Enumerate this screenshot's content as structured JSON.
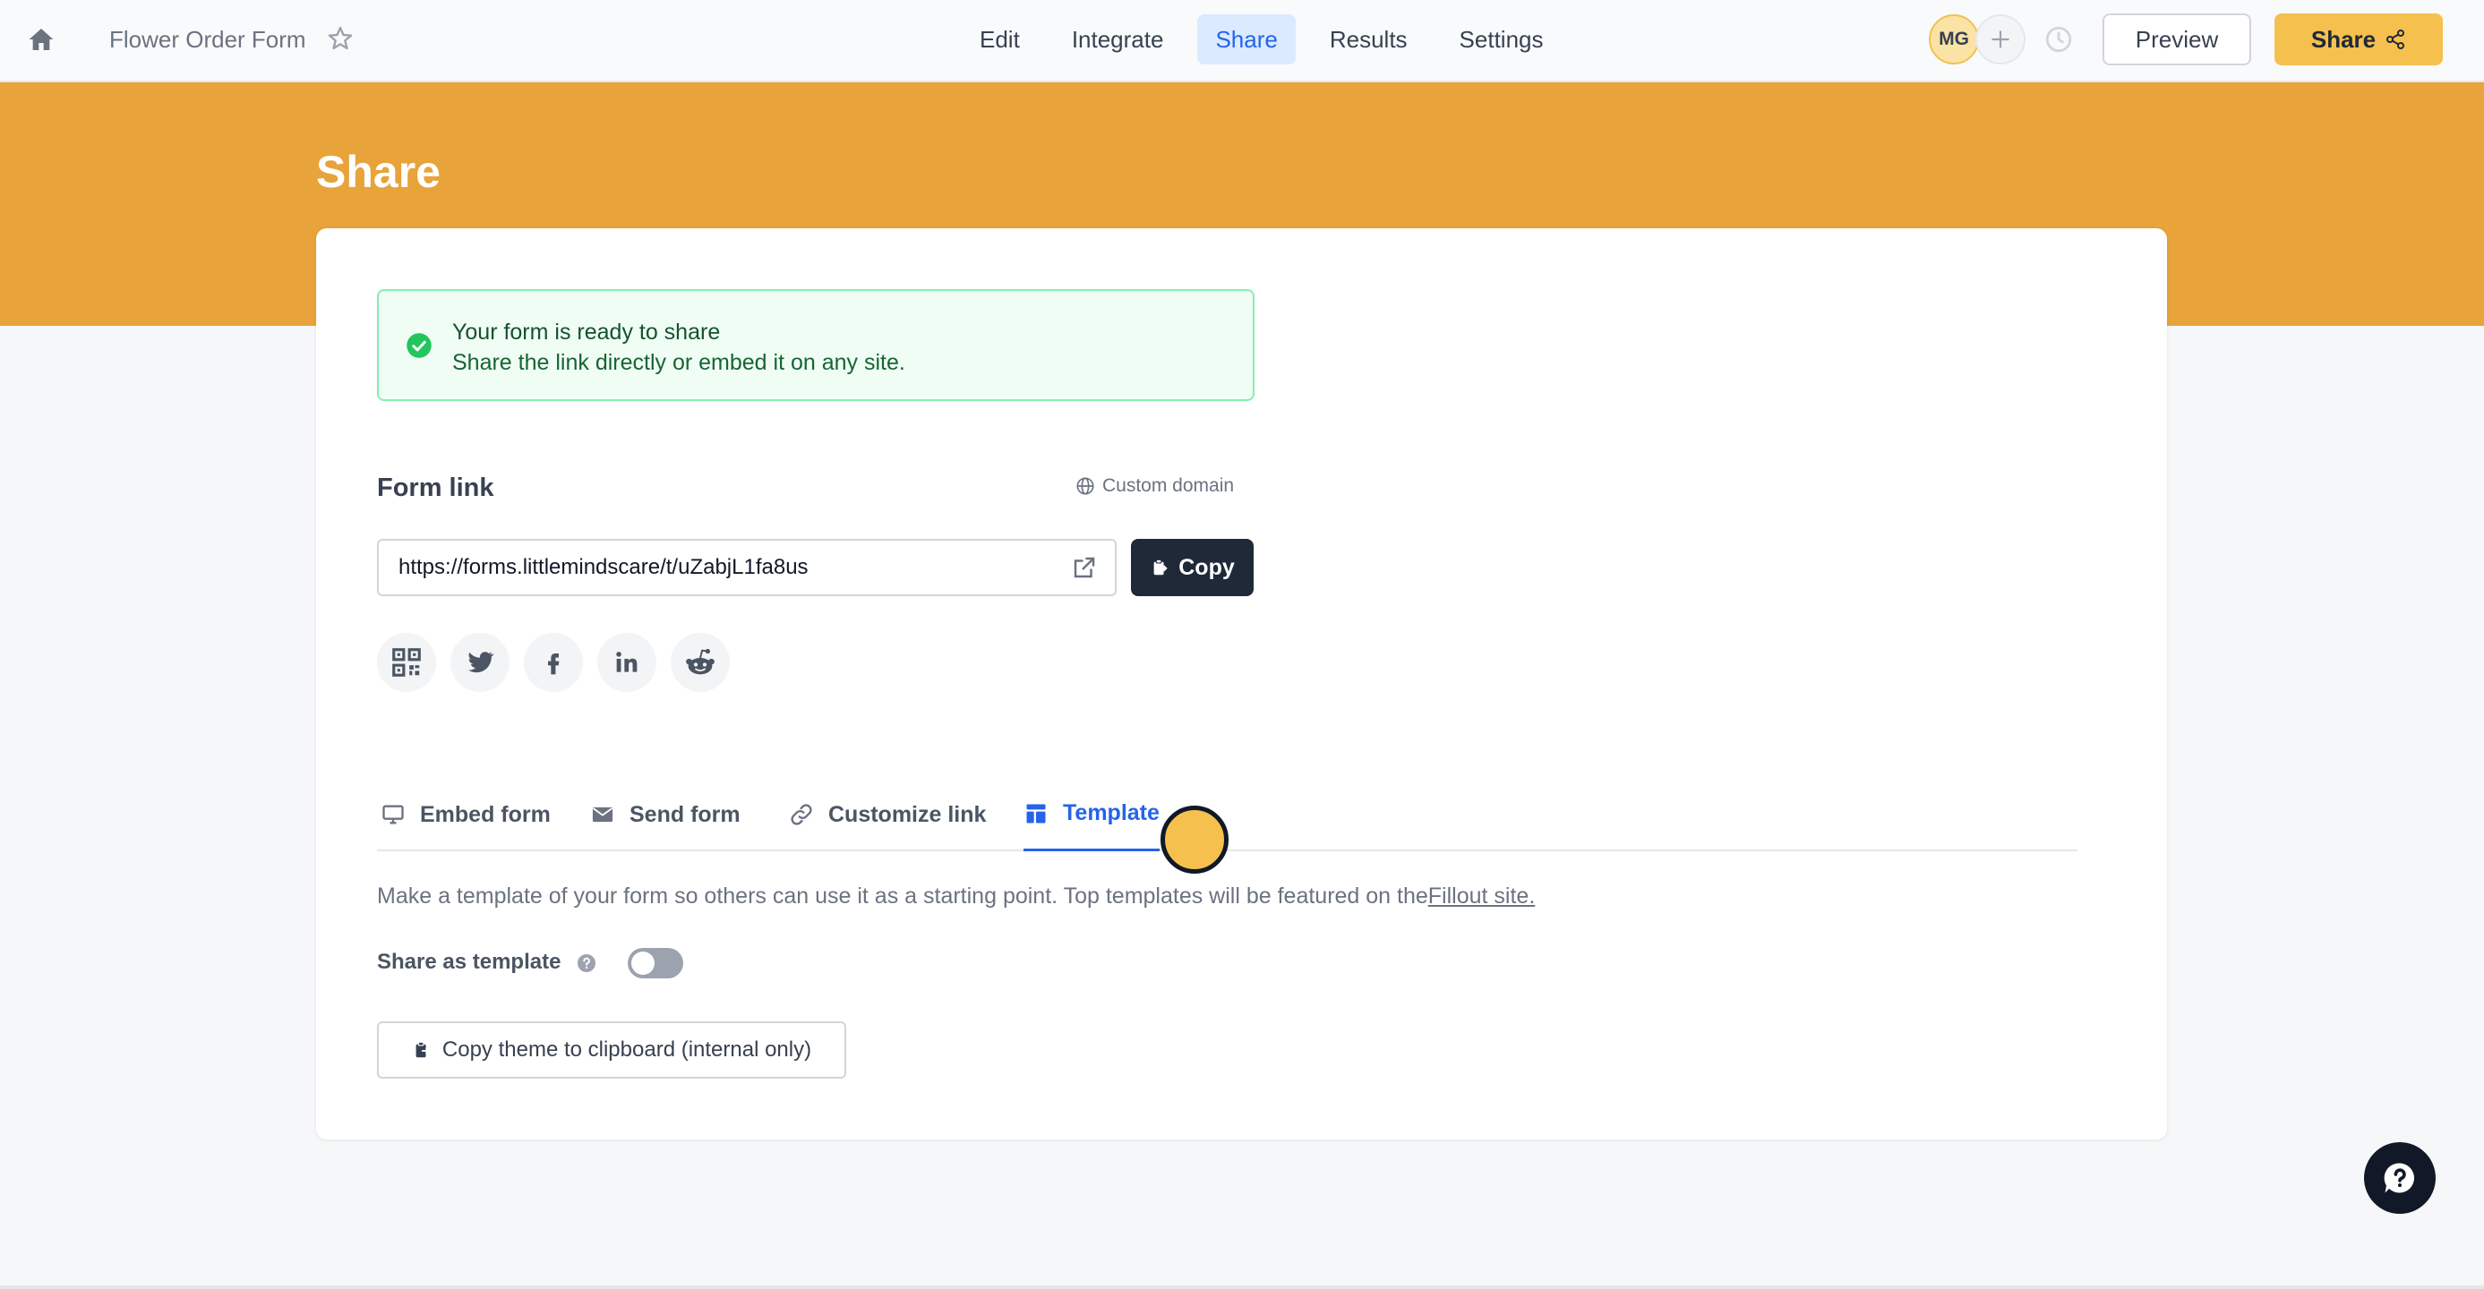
{
  "topbar": {
    "form_title": "Flower Order Form",
    "nav": [
      {
        "label": "Edit"
      },
      {
        "label": "Integrate"
      },
      {
        "label": "Share",
        "active": true
      },
      {
        "label": "Results"
      },
      {
        "label": "Settings"
      }
    ],
    "avatar_initials": "MG",
    "preview_label": "Preview",
    "share_label": "Share"
  },
  "header": {
    "title": "Share"
  },
  "alert": {
    "title": "Your form is ready to share",
    "text": "Share the link directly or embed it on any site."
  },
  "form_link": {
    "label": "Form link",
    "custom_domain_label": "Custom domain",
    "url": "https://forms.littlemindscare/t/uZabjL1fa8us",
    "copy_label": "Copy"
  },
  "social_icons": [
    "qr-code-icon",
    "twitter-icon",
    "facebook-icon",
    "linkedin-icon",
    "reddit-icon"
  ],
  "tabs": [
    {
      "label": "Embed form",
      "icon": "monitor-icon"
    },
    {
      "label": "Send form",
      "icon": "envelope-icon"
    },
    {
      "label": "Customize link",
      "icon": "link-icon"
    },
    {
      "label": "Template",
      "icon": "template-icon",
      "active": true
    }
  ],
  "template_panel": {
    "description": "Make a template of your form so others can use it as a starting point. Top templates will be featured on the",
    "link_text": "Fillout site.",
    "share_as_template_label": "Share as template",
    "share_as_template_enabled": false,
    "copy_theme_label": "Copy theme to clipboard (internal only)"
  },
  "colors": {
    "accent_orange": "#e8a33a",
    "share_button": "#f5c04e",
    "active_blue": "#2563eb",
    "success_green": "#22c55e"
  }
}
